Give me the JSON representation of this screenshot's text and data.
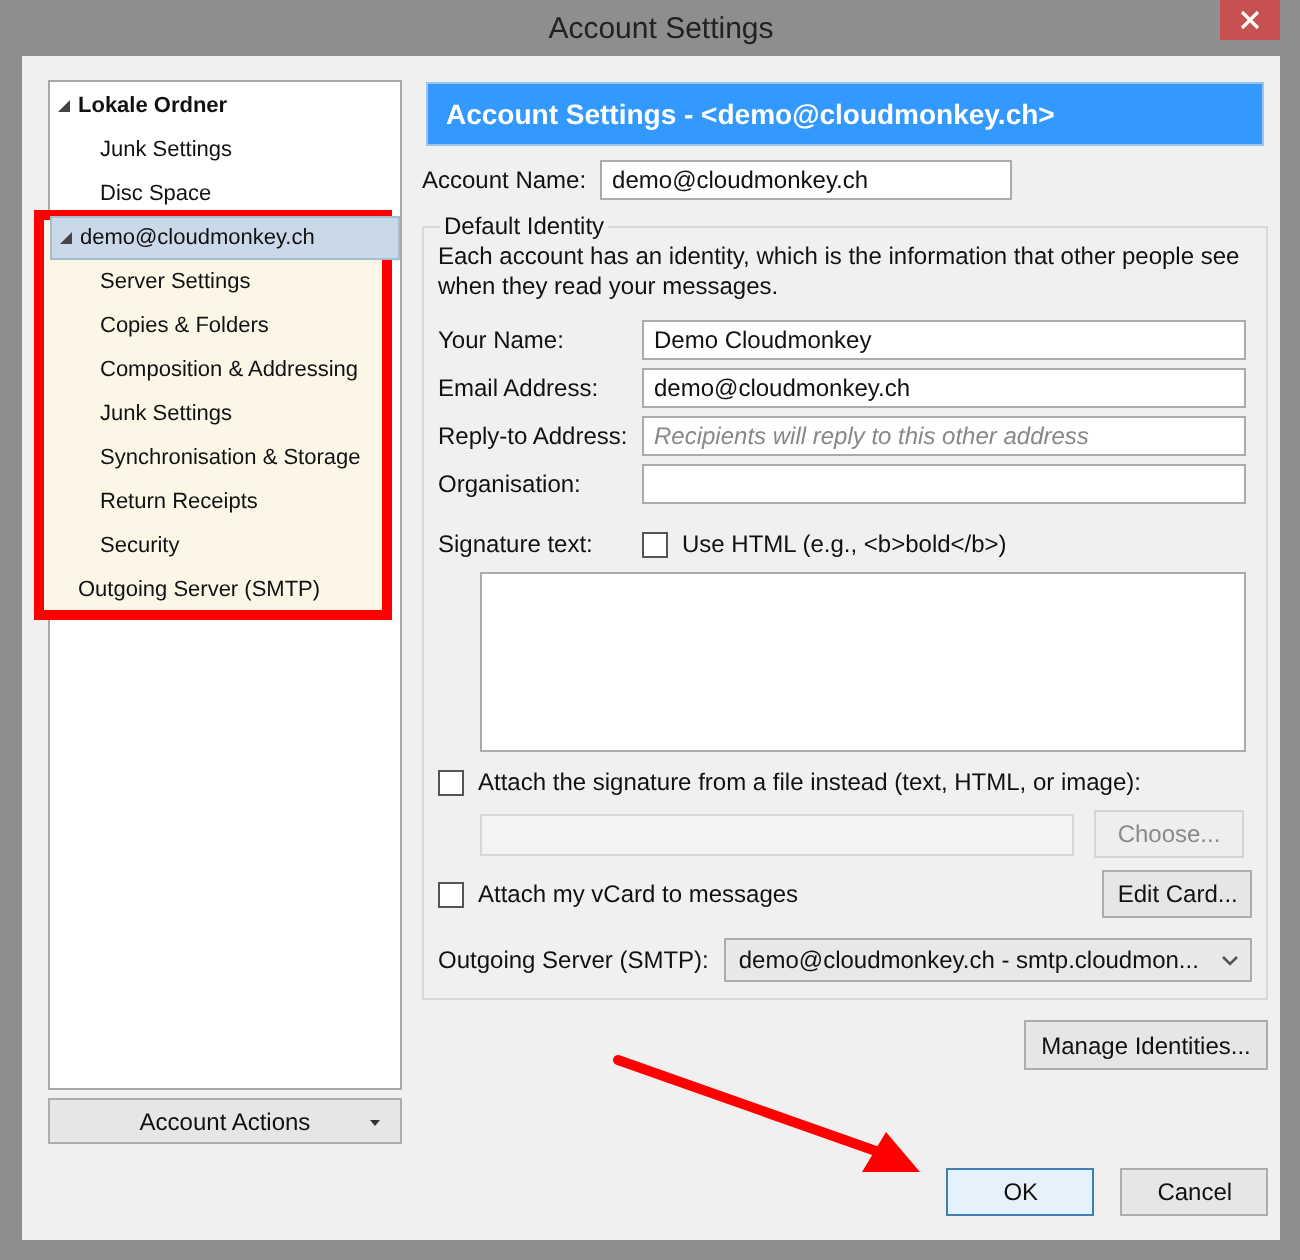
{
  "window": {
    "title": "Account Settings"
  },
  "tree": [
    {
      "label": "Lokale Ordner",
      "kind": "folder",
      "expanded": true,
      "selected": false,
      "children": [
        {
          "label": "Junk Settings",
          "selected": false
        },
        {
          "label": "Disc Space",
          "selected": false
        }
      ]
    },
    {
      "label": "demo@cloudmonkey.ch",
      "kind": "account",
      "expanded": true,
      "selected": true,
      "children": [
        {
          "label": "Server Settings",
          "selected": false
        },
        {
          "label": "Copies & Folders",
          "selected": false
        },
        {
          "label": "Composition & Addressing",
          "selected": false
        },
        {
          "label": "Junk Settings",
          "selected": false
        },
        {
          "label": "Synchronisation & Storage",
          "selected": false
        },
        {
          "label": "Return Receipts",
          "selected": false
        },
        {
          "label": "Security",
          "selected": false
        }
      ]
    },
    {
      "label": "Outgoing Server (SMTP)",
      "kind": "server",
      "selected": false
    }
  ],
  "account_actions": {
    "label": "Account Actions"
  },
  "header": "Account Settings - <demo@cloudmonkey.ch>",
  "account_name": {
    "label": "Account Name:",
    "value": "demo@cloudmonkey.ch"
  },
  "identity": {
    "legend": "Default Identity",
    "description": "Each account has an identity, which is the information that other people see when they read your messages.",
    "fields": [
      {
        "label": "Your Name:",
        "value": "Demo Cloudmonkey"
      },
      {
        "label": "Email Address:",
        "value": "demo@cloudmonkey.ch"
      },
      {
        "label": "Reply-to Address:",
        "placeholder": "Recipients will reply to this other address"
      },
      {
        "label": "Organisation:"
      }
    ],
    "signature_label": "Signature text:",
    "use_html": {
      "label": "Use HTML (e.g., <b>bold</b>)",
      "checked": false
    },
    "attach_file": {
      "label": "Attach the signature from a file instead (text, HTML, or image):",
      "checked": false
    },
    "choose_button": {
      "label": "Choose...",
      "disabled": true
    },
    "vcard": {
      "label": "Attach my vCard to messages",
      "checked": false
    },
    "edit_card_button": {
      "label": "Edit Card...",
      "disabled": false
    },
    "outgoing": {
      "label": "Outgoing Server (SMTP):",
      "value": "demo@cloudmonkey.ch - smtp.cloudmon..."
    }
  },
  "manage_button": "Manage Identities...",
  "buttons": [
    {
      "label": "OK",
      "selected": true
    },
    {
      "label": "Cancel",
      "selected": false
    }
  ]
}
